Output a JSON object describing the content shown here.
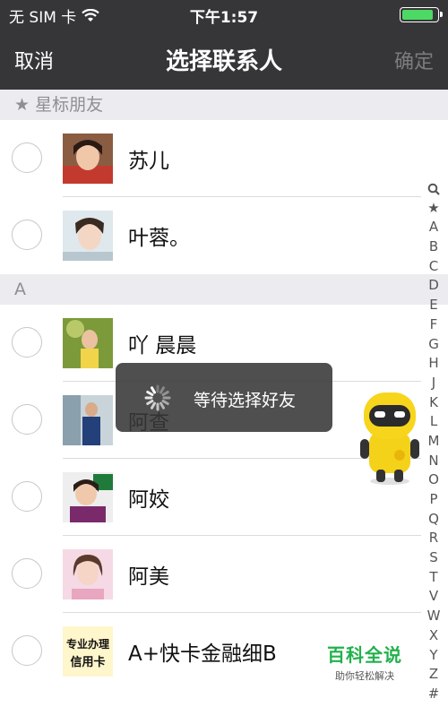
{
  "status_bar": {
    "carrier": "无 SIM 卡",
    "time": "下午1:57",
    "battery_level": 0.85
  },
  "nav": {
    "cancel": "取消",
    "title": "选择联系人",
    "confirm": "确定"
  },
  "sections": [
    {
      "header": "★  星标朋友",
      "contacts": [
        "苏儿",
        "叶蓉。"
      ]
    },
    {
      "header": "A",
      "contacts": [
        "吖 晨晨",
        "阿查",
        "阿姣",
        "阿美",
        "A+快卡金融细B"
      ]
    }
  ],
  "avatar_texts": {
    "card_line1": "专业办理",
    "card_line2": "信用卡"
  },
  "index_bar": [
    "search-icon",
    "★",
    "A",
    "B",
    "C",
    "D",
    "E",
    "F",
    "G",
    "H",
    "J",
    "K",
    "L",
    "M",
    "N",
    "O",
    "P",
    "Q",
    "R",
    "S",
    "T",
    "V",
    "W",
    "X",
    "Y",
    "Z",
    "#"
  ],
  "toast": {
    "text": "等待选择好友"
  },
  "watermark": {
    "title": "百科全说",
    "subtitle": "助你轻松解决"
  },
  "colors": {
    "nav_bg": "#363638",
    "section_bg": "#ececf0",
    "battery": "#4cd964",
    "watermark": "#22b14c"
  }
}
